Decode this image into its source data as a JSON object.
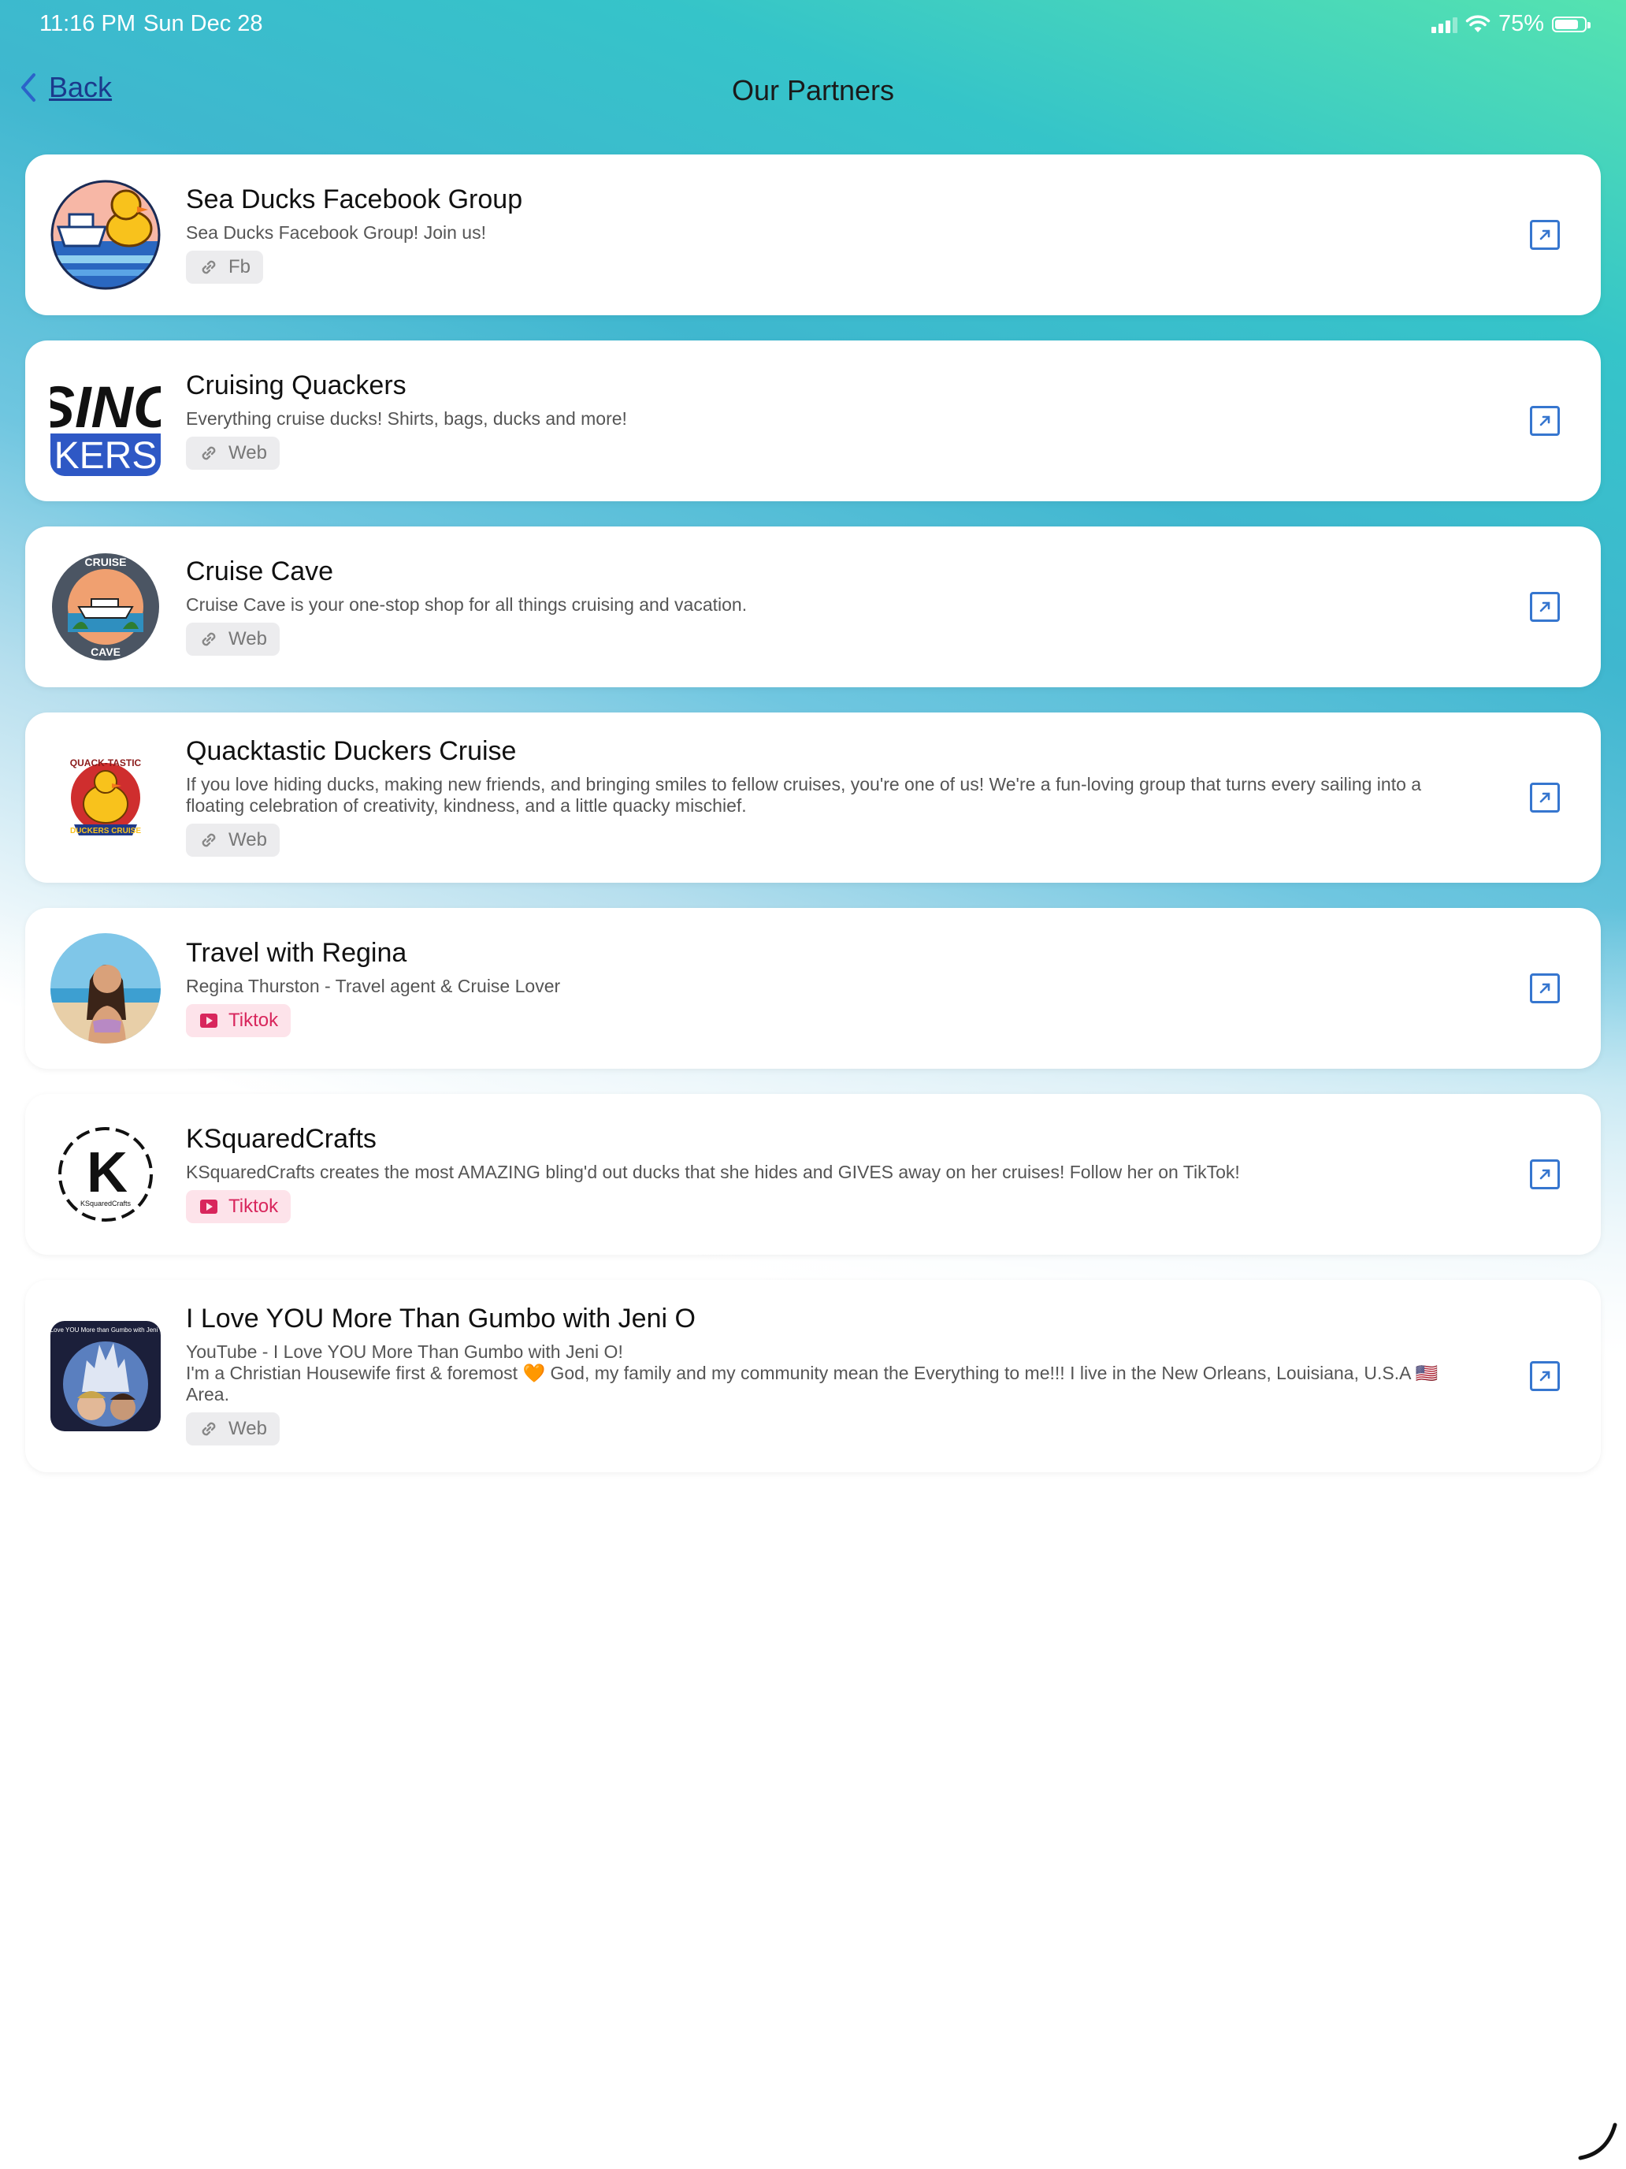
{
  "status": {
    "time": "11:16 PM",
    "date": "Sun Dec 28",
    "battery": "75%"
  },
  "nav": {
    "back": "Back",
    "title": "Our Partners"
  },
  "partners": [
    {
      "title": "Sea Ducks Facebook Group",
      "desc": "Sea Ducks Facebook Group! Join us!",
      "chip": "Fb"
    },
    {
      "title": "Cruising Quackers",
      "desc": "Everything cruise ducks! Shirts, bags, ducks and more!",
      "chip": "Web"
    },
    {
      "title": "Cruise Cave",
      "desc": "Cruise Cave is your one-stop shop for all things cruising and vacation.",
      "chip": "Web"
    },
    {
      "title": "Quacktastic Duckers Cruise",
      "desc": "If you love hiding ducks, making new friends, and bringing smiles to fellow cruises, you're one of us! We're a fun-loving group that turns every sailing into a floating celebration of creativity, kindness, and a little quacky mischief.",
      "chip": "Web"
    },
    {
      "title": "Travel with Regina",
      "desc": "Regina Thurston - Travel agent & Cruise Lover",
      "chip": "Tiktok"
    },
    {
      "title": "KSquaredCrafts",
      "desc": "KSquaredCrafts creates the most AMAZING bling'd out ducks that she hides and GIVES away on her cruises! Follow her on TikTok!",
      "chip": "Tiktok"
    },
    {
      "title": "I Love YOU More Than Gumbo with Jeni O",
      "desc_line1": "YouTube - I Love YOU More Than Gumbo with Jeni O!",
      "desc_line2": "I'm a Christian Housewife first & foremost 🧡 God, my family and my community mean the Everything to me!!! I live in the New Orleans, Louisiana, U.S.A 🇺🇸 Area.",
      "chip": "Web"
    }
  ],
  "logos": {
    "cruising_quackers_top": "SINC",
    "cruising_quackers_bottom": "KERS",
    "cruise_cave_top": "CRUISE",
    "cruise_cave_bottom": "CAVE",
    "quacktastic_top": "QUACK-TASTIC",
    "quacktastic_bottom": "DUCKERS CRUISE",
    "ksquared_letter": "K",
    "ksquared_name": "KSquaredCrafts",
    "gumbo_caption": "I Love YOU More than Gumbo with Jeni O"
  }
}
